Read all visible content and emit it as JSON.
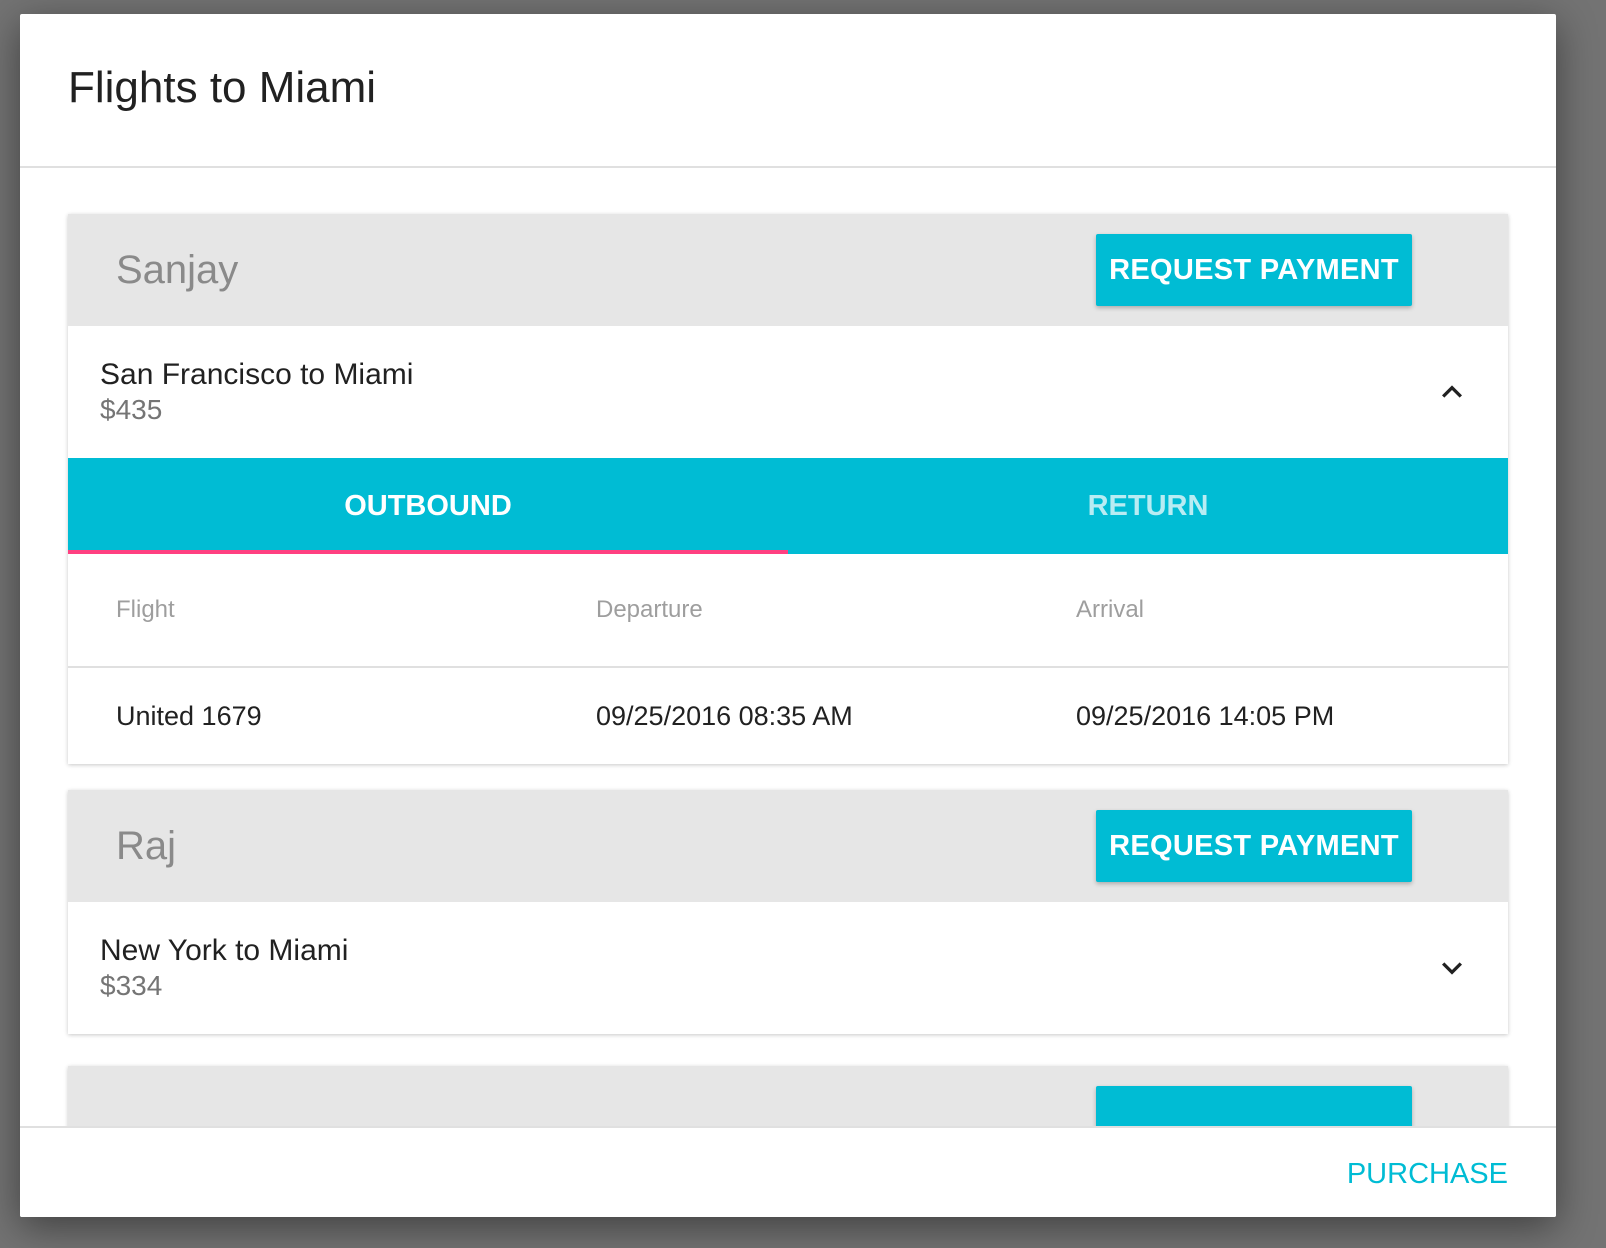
{
  "dialog": {
    "title": "Flights to Miami",
    "purchase_label": "PURCHASE"
  },
  "passengers": [
    {
      "name": "Sanjay",
      "request_label": "REQUEST PAYMENT",
      "route": "San Francisco to Miami",
      "price": "$435",
      "expanded": true,
      "tabs": [
        "OUTBOUND",
        "RETURN"
      ],
      "active_tab": "OUTBOUND",
      "table": {
        "headers": [
          "Flight",
          "Departure",
          "Arrival"
        ],
        "rows": [
          [
            "United 1679",
            "09/25/2016 08:35 AM",
            "09/25/2016 14:05 PM"
          ]
        ]
      }
    },
    {
      "name": "Raj",
      "request_label": "REQUEST PAYMENT",
      "route": "New York to Miami",
      "price": "$334",
      "expanded": false
    },
    {
      "name": "",
      "request_label": ""
    }
  ],
  "colors": {
    "accent": "#00bcd4",
    "tab_indicator": "#ff4081",
    "header_bg": "#e6e6e6"
  },
  "icons": {
    "expanded": "chevron-up-icon",
    "collapsed": "chevron-down-icon"
  }
}
